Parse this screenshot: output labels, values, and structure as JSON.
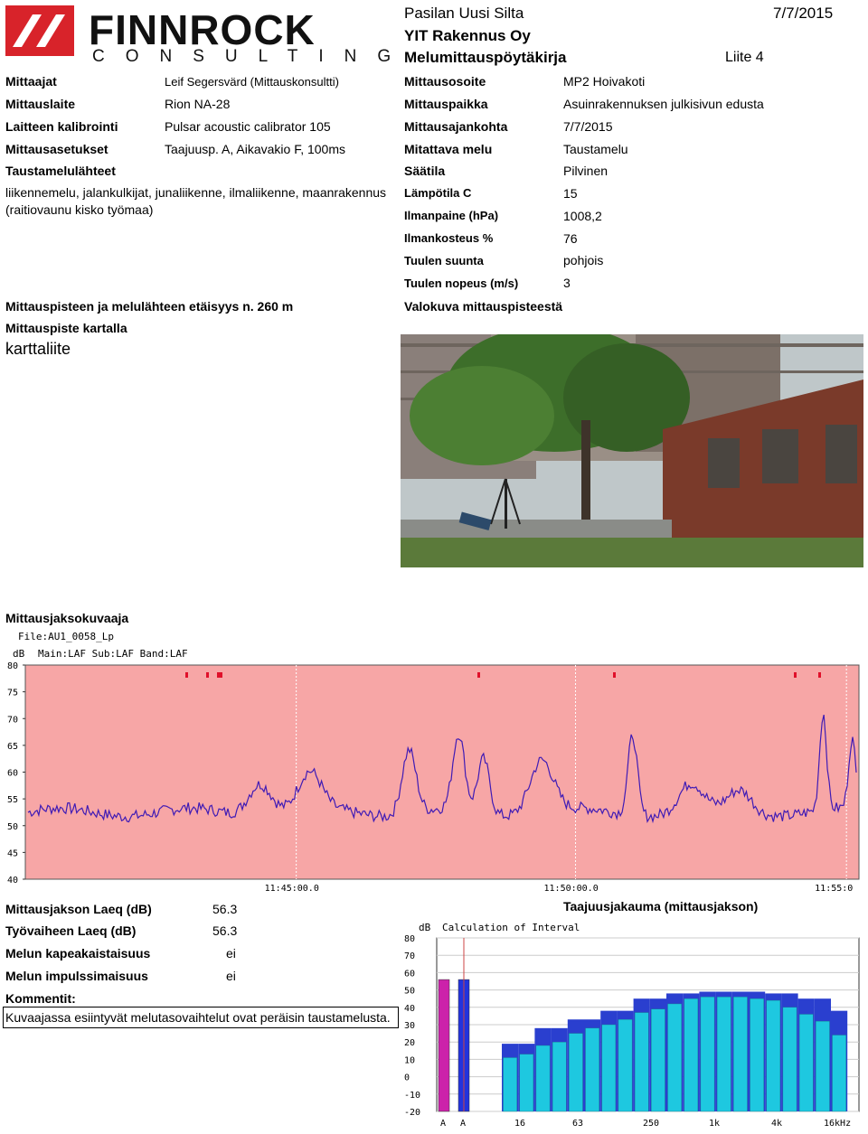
{
  "logo": {
    "name": "FINNROCK",
    "sub": "CONSULTING"
  },
  "header": {
    "site": "Pasilan Uusi Silta",
    "client": "YIT Rakennus Oy",
    "doc_title": "Melumittauspöytäkirja",
    "appendix": "Liite 4",
    "date": "7/7/2015"
  },
  "left_fields": [
    {
      "label": "Mittaajat",
      "value": "Leif Segersvärd (Mittauskonsultti)"
    },
    {
      "label": "Mittauslaite",
      "value": "Rion NA-28"
    },
    {
      "label": "Laitteen kalibrointi",
      "value": "Pulsar acoustic calibrator 105"
    },
    {
      "label": "Mittausasetukset",
      "value": "Taajuusp. A, Aikavakio F, 100ms"
    }
  ],
  "right_fields": [
    {
      "label": "Mittausosoite",
      "value": "MP2 Hoivakoti"
    },
    {
      "label": "Mittauspaikka",
      "value": "Asuinrakennuksen julkisivun edusta"
    },
    {
      "label": "Mittausajankohta",
      "value": "7/7/2015"
    },
    {
      "label": "Mitattava melu",
      "value": "Taustamelu"
    }
  ],
  "sources": {
    "label": "Taustamelulähteet",
    "line1": "liikennemelu, jalankulkijat, junaliikenne, ilmaliikenne, maanrakennus",
    "line2": "(raitiovaunu kisko työmaa)"
  },
  "weather": [
    {
      "label": "Säätila",
      "value": "Pilvinen"
    },
    {
      "label": "Lämpötila C",
      "value": "15"
    },
    {
      "label": "Ilmanpaine (hPa)",
      "value": "1008,2"
    },
    {
      "label": "Ilmankosteus %",
      "value": "76"
    },
    {
      "label": "Tuulen suunta",
      "value": "pohjois"
    },
    {
      "label": "Tuulen nopeus (m/s)",
      "value": "3"
    }
  ],
  "distance": "Mittauspisteen ja melulähteen etäisyys n. 260 m",
  "map_label": "Mittauspiste kartalla",
  "map_value": "karttaliite",
  "photo_label": "Valokuva mittauspisteestä",
  "timeline_label": "Mittausjaksokuvaaja",
  "results": [
    {
      "label": "Mittausjakson Laeq (dB)",
      "value": "56.3"
    },
    {
      "label": "Työvaiheen Laeq (dB)",
      "value": "56.3"
    },
    {
      "label": "Melun kapeakaistaisuus",
      "value": "ei"
    },
    {
      "label": "Melun impulssimaisuus",
      "value": "ei"
    }
  ],
  "comments_label": "Kommentit:",
  "comments_text": "Kuvaajassa esiintyvät melutasovaihtelut ovat peräisin taustamelusta.",
  "spectrum_label": "Taajuusjakauma (mittausjakson)",
  "chart_data": [
    {
      "type": "line",
      "file": "File:AU1_0058_Lp",
      "header": "Main:LAF Sub:LAF Band:LAF",
      "ylabel": "dB",
      "ylim": [
        40,
        80
      ],
      "yticks": [
        "80",
        "75",
        "70",
        "65",
        "60",
        "55",
        "50",
        "45",
        "40"
      ],
      "xticks": [
        "11:45:00.0",
        "11:50:00.0",
        "11:55:0"
      ],
      "colors": {
        "background": "#f7a6a6",
        "line": "#3f1bb5",
        "marker": "#e0102a"
      }
    },
    {
      "type": "bar",
      "title": "Calculation of Interval",
      "ylabel": "dB",
      "ylim": [
        -20,
        80
      ],
      "yticks": [
        "80",
        "70",
        "60",
        "50",
        "40",
        "30",
        "20",
        "10",
        "0",
        "-10",
        "-20"
      ],
      "xticks": [
        "A",
        "A",
        "16",
        "63",
        "250",
        "1k",
        "4k",
        "16kHz"
      ],
      "overall": [
        {
          "name": "A",
          "value": 56,
          "color": "#cc22aa"
        },
        {
          "name": "A",
          "value": 56,
          "color": "#2233dd"
        }
      ],
      "band_max": [
        19,
        19,
        28,
        28,
        33,
        33,
        38,
        38,
        45,
        45,
        48,
        48,
        49,
        49,
        49,
        49,
        48,
        48,
        45,
        45,
        38
      ],
      "band_values": [
        11,
        13,
        18,
        20,
        25,
        28,
        30,
        33,
        37,
        39,
        42,
        45,
        46,
        46,
        46,
        45,
        44,
        40,
        36,
        32,
        24
      ],
      "colors": {
        "max": "#2a3fcf",
        "value": "#1ec8e0"
      }
    }
  ]
}
